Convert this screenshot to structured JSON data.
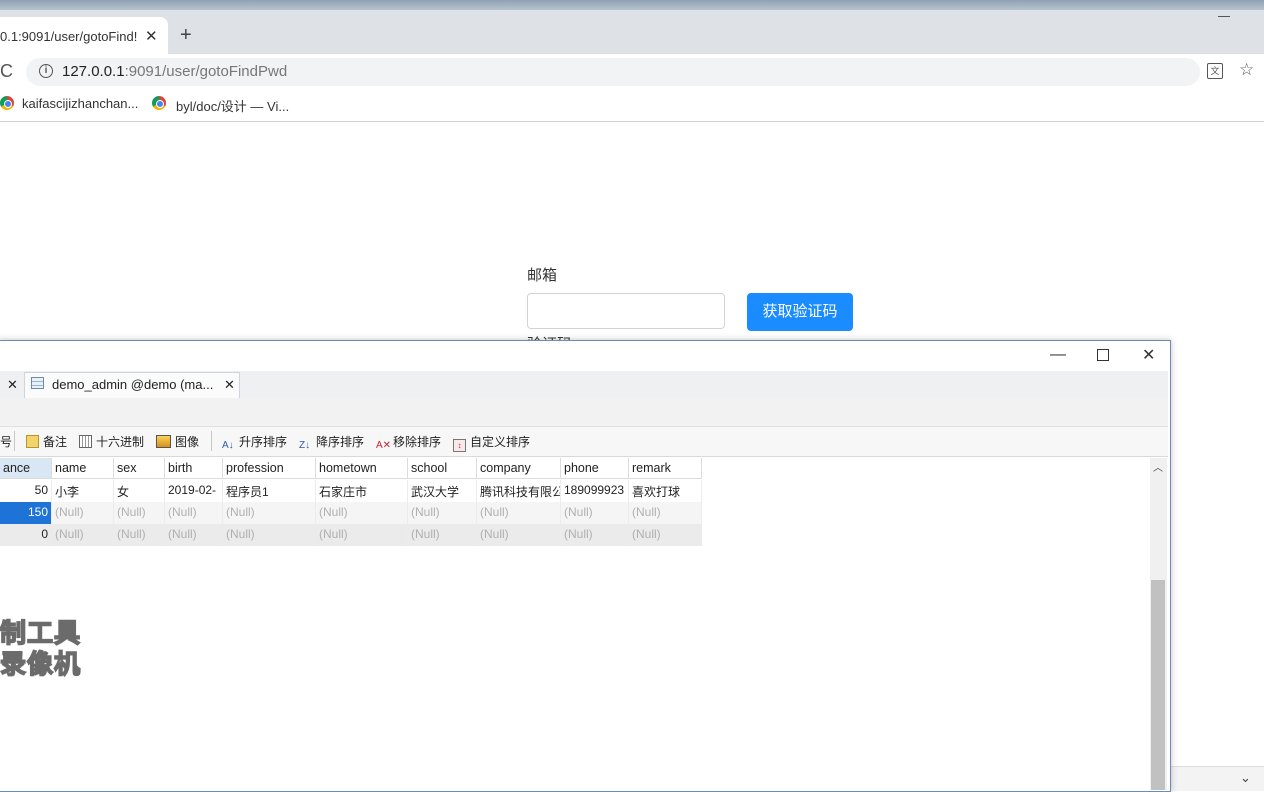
{
  "browser": {
    "tab_title": "0.1:9091/user/gotoFind!",
    "new_tab_label": "+",
    "close_label": "✕",
    "url_host": "127.0.0.1",
    "url_rest": ":9091/user/gotoFindPwd",
    "bookmarks": [
      "kaifascijizhanchan...",
      "byl/doc/设计 — Vi..."
    ]
  },
  "page": {
    "email_label": "邮箱",
    "get_code_button": "获取验证码",
    "code_label": "验证码"
  },
  "navicat": {
    "tab_title": "demo_admin @demo (ma...",
    "toolbar": {
      "memo": "备注",
      "hex": "十六进制",
      "image": "图像",
      "sort_asc": "升序排序",
      "sort_desc": "降序排序",
      "remove_sort": "移除排序",
      "custom_sort": "自定义排序"
    },
    "columns": [
      "ance",
      "name",
      "sex",
      "birth",
      "profession",
      "hometown",
      "school",
      "company",
      "phone",
      "remark"
    ],
    "rows": [
      [
        "50",
        "小李",
        "女",
        "2019-02-",
        "程序员1",
        "石家庄市",
        "武汉大学",
        "腾讯科技有限公",
        "189099923",
        "喜欢打球"
      ],
      [
        "150",
        "(Null)",
        "(Null)",
        "(Null)",
        "(Null)",
        "(Null)",
        "(Null)",
        "(Null)",
        "(Null)",
        "(Null)"
      ],
      [
        "0",
        "(Null)",
        "(Null)",
        "(Null)",
        "(Null)",
        "(Null)",
        "(Null)",
        "(Null)",
        "(Null)",
        "(Null)"
      ]
    ],
    "watermark": [
      "制工具",
      "录像机"
    ]
  }
}
